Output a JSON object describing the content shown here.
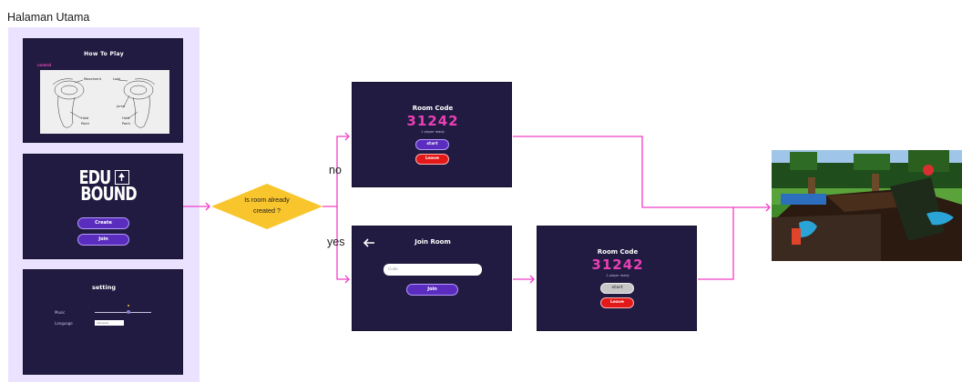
{
  "section_title": "Halaman Utama",
  "how_to_play": {
    "title": "How To Play",
    "control_label": "control",
    "labels": {
      "movement": "Movement",
      "look": "Look",
      "jump": "Jump",
      "hold_left": "Hold",
      "point_left": "Point",
      "hold_right": "Hold",
      "point_right": "Point"
    }
  },
  "menu": {
    "logo_line1": "EDU",
    "logo_line2": "BOUND",
    "create_label": "Create",
    "join_label": "Join"
  },
  "setting": {
    "title": "setting",
    "music_label": "Music",
    "language_label": "Language",
    "language_value": "Indonesia"
  },
  "decision": {
    "line1": "Is room already",
    "line2": "created ?",
    "no_label": "no",
    "yes_label": "yes"
  },
  "room_created": {
    "title": "Room Code",
    "code": "31242",
    "ready_text": "1 player ready",
    "start_label": "start",
    "leave_label": "Leave"
  },
  "join_room": {
    "title": "Join Room",
    "input_placeholder": "Code",
    "join_label": "Join"
  },
  "room_joined": {
    "title": "Room Code",
    "code": "31242",
    "ready_text": "1 player ready",
    "start_label": "start",
    "leave_label": "Leave"
  },
  "colors": {
    "flow_line": "#f13ec8",
    "screen_bg": "#211b41",
    "decision_fill": "#f9c52c",
    "code_pink": "#ea3fb3",
    "panel_bg": "#ebe2ff"
  }
}
